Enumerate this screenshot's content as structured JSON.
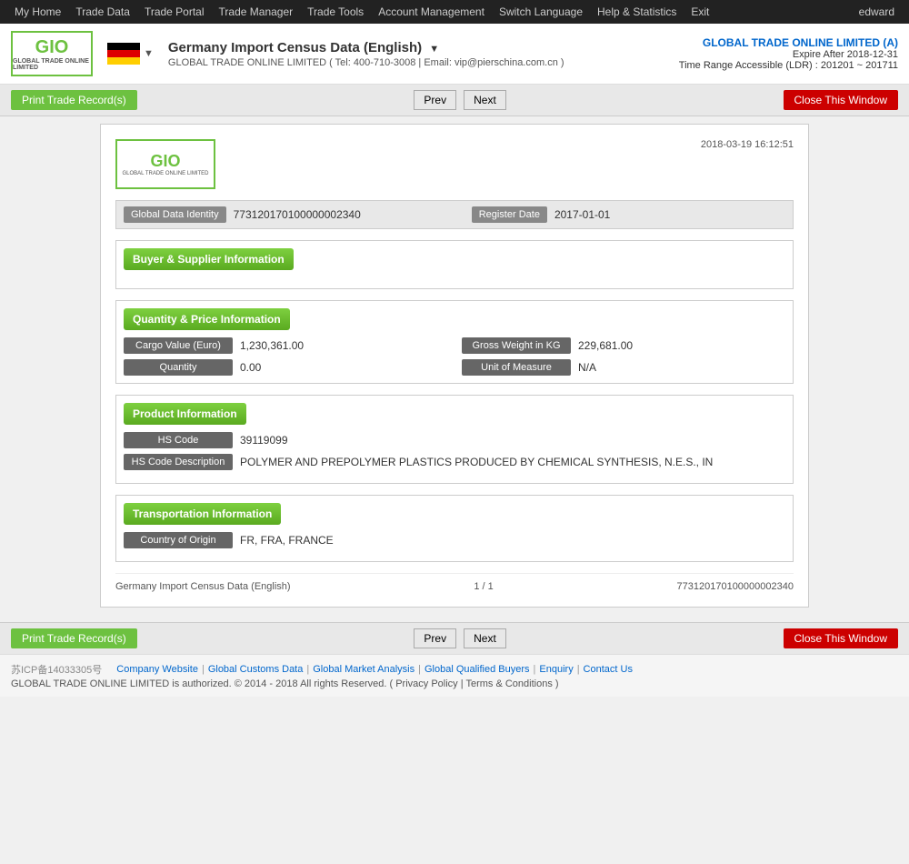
{
  "topnav": {
    "items": [
      {
        "label": "My Home",
        "id": "my-home"
      },
      {
        "label": "Trade Data",
        "id": "trade-data"
      },
      {
        "label": "Trade Portal",
        "id": "trade-portal"
      },
      {
        "label": "Trade Manager",
        "id": "trade-manager"
      },
      {
        "label": "Trade Tools",
        "id": "trade-tools"
      },
      {
        "label": "Account Management",
        "id": "account-management"
      },
      {
        "label": "Switch Language",
        "id": "switch-language"
      },
      {
        "label": "Help & Statistics",
        "id": "help-statistics"
      },
      {
        "label": "Exit",
        "id": "exit"
      }
    ],
    "user": "edward"
  },
  "header": {
    "logo_text": "GIO",
    "logo_sub": "GLOBAL TRADE ONLINE LIMITED",
    "flag_alt": "Germany",
    "title": "Germany Import Census Data (English)",
    "title_arrow": "▼",
    "contact": "GLOBAL TRADE ONLINE LIMITED ( Tel: 400-710-3008  |  Email: vip@pierschina.com.cn )",
    "company_name": "GLOBAL TRADE ONLINE LIMITED (A)",
    "expire": "Expire After 2018-12-31",
    "ldr": "Time Range Accessible (LDR) : 201201 ~ 201711"
  },
  "toolbar": {
    "print_label": "Print Trade Record(s)",
    "prev_label": "Prev",
    "next_label": "Next",
    "close_label": "Close This Window"
  },
  "record": {
    "timestamp": "2018-03-19 16:12:51",
    "global_data_identity_label": "Global Data Identity",
    "global_data_identity_value": "773120170100000002340",
    "register_date_label": "Register Date",
    "register_date_value": "2017-01-01",
    "sections": {
      "buyer_supplier": {
        "title": "Buyer & Supplier Information",
        "fields": []
      },
      "quantity_price": {
        "title": "Quantity & Price Information",
        "fields": [
          {
            "label": "Cargo Value (Euro)",
            "value": "1,230,361.00",
            "col": "left"
          },
          {
            "label": "Gross Weight in KG",
            "value": "229,681.00",
            "col": "right"
          },
          {
            "label": "Quantity",
            "value": "0.00",
            "col": "left"
          },
          {
            "label": "Unit of Measure",
            "value": "N/A",
            "col": "right"
          }
        ]
      },
      "product": {
        "title": "Product Information",
        "fields": [
          {
            "label": "HS Code",
            "value": "39119099"
          },
          {
            "label": "HS Code Description",
            "value": "POLYMER AND PREPOLYMER PLASTICS PRODUCED BY CHEMICAL SYNTHESIS, N.E.S., IN"
          }
        ]
      },
      "transportation": {
        "title": "Transportation Information",
        "fields": [
          {
            "label": "Country of Origin",
            "value": "FR, FRA, FRANCE"
          }
        ]
      }
    },
    "footer": {
      "left": "Germany Import Census Data (English)",
      "center": "1 / 1",
      "right": "773120170100000002340"
    }
  },
  "footer": {
    "icp": "苏ICP备14033305号",
    "links": [
      "Company Website",
      "Global Customs Data",
      "Global Market Analysis",
      "Global Qualified Buyers",
      "Enquiry",
      "Contact Us"
    ],
    "copyright": "GLOBAL TRADE ONLINE LIMITED is authorized. © 2014 - 2018 All rights Reserved.  (  Privacy Policy  |  Terms & Conditions  )"
  }
}
